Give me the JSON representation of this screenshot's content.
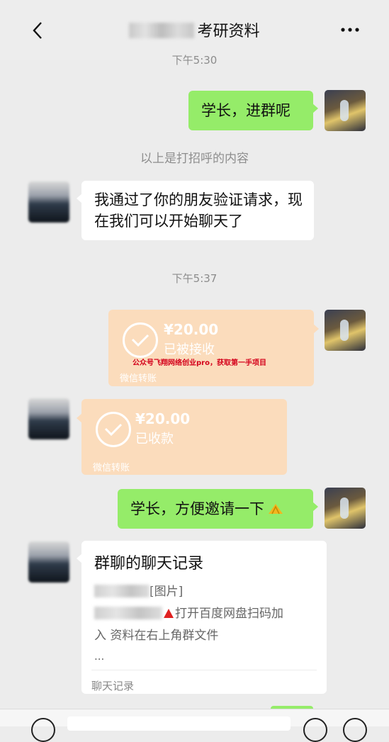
{
  "header": {
    "title": "考研资料",
    "back_icon": "chevron-left-icon",
    "more_icon": "more-dots-icon"
  },
  "messages": {
    "time1": "下午5:30",
    "msg1": "学长，进群呢",
    "greeting_note": "以上是打招呼的内容",
    "msg2": "我通过了你的朋友验证请求，现在我们可以开始聊天了",
    "time2": "下午5:37",
    "transfer1": {
      "amount": "¥20.00",
      "status": "已被接收",
      "footer": "微信转账",
      "watermark": "公众号飞翔网络创业pro，获取第一手项目"
    },
    "transfer2": {
      "amount": "¥20.00",
      "status": "已收款",
      "footer": "微信转账"
    },
    "msg3": "学长，方便邀请一下",
    "record": {
      "title": "群聊的聊天记录",
      "line1": "[图片]",
      "line2": "打开百度网盘扫码加",
      "line3": "入 资料在右上角群文件",
      "line4": "...",
      "footer": "聊天记录"
    }
  },
  "colors": {
    "sent_bubble": "#95ec69",
    "transfer_bubble": "#fbdcbc",
    "background": "#ececec"
  }
}
